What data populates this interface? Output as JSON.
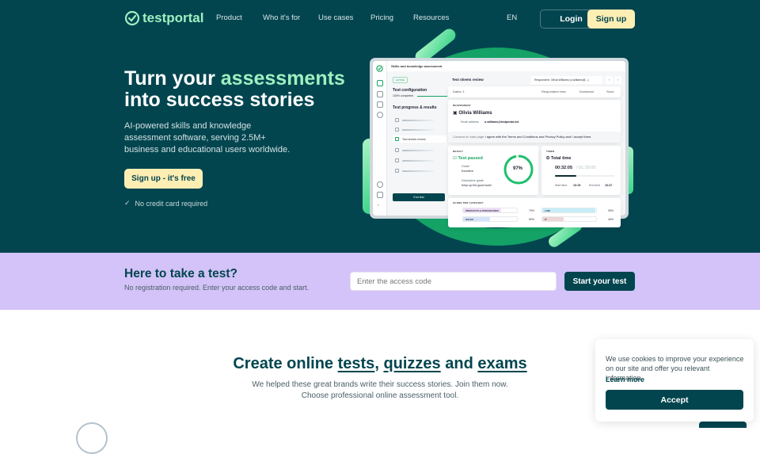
{
  "brand": {
    "name": "testportal",
    "accent": "#9ef0c0",
    "primary": "#02454f",
    "cta": "#fdeeb4",
    "band": "#d3c3f8"
  },
  "nav": {
    "items": [
      "Product",
      "Who it's for",
      "Use cases",
      "Pricing",
      "Resources"
    ],
    "lang": "EN",
    "login": "Login",
    "signup": "Sign up"
  },
  "hero": {
    "title_pre": "Turn your",
    "title_accent": "assessments",
    "title_post": "into success stories",
    "subtitle": "AI-powered skills and knowledge assessment software, serving 2.5M+ business and educational users worldwide.",
    "cta": "Sign up - it's free",
    "note": "No credit card required"
  },
  "app": {
    "title": "Skills and knowledge assessment",
    "status": "ACTIVE",
    "config_title": "Test configuration",
    "config_progress": "100% completed",
    "progress_title": "Test progress & results",
    "active_step": "Test sheets review",
    "end_test": "End test",
    "main_title": "Test sheets review",
    "respondent_select": "Respondent: Olivia Williams (o.williams@...)",
    "dates": "Dates: 1",
    "respondent_view": "Respondent view",
    "download": "Download",
    "send": "Send",
    "respondent_caption": "RESPONDENT",
    "respondent_name": "Olivia Williams",
    "email_label": "Email address",
    "email": "o.williams@testportal.net",
    "consent_label": "Consent on start page",
    "consent_text": "I agree with the Terms and Conditions and Privacy Policy and I accept them.",
    "result_caption": "RESULT",
    "result_status": "Test passed",
    "grade_label": "Grade",
    "grade": "Excellent",
    "desc_grade_label": "Descriptive grade",
    "desc_grade": "Keep up the good work!",
    "score_percent": 97,
    "score_label": "97%",
    "timer_caption": "TIMER",
    "timer_title": "Total time",
    "elapsed": "00:32:05",
    "limit": "01:30:00",
    "time_progress": 0.36,
    "start_label": "Start time",
    "start_time": "10:15",
    "end_label": "End time",
    "end_time": "10:47",
    "score_caption": "SCORE PER CATEGORY",
    "categories": [
      {
        "name": "PRODUCTS & PROCEDURES",
        "pct": 70,
        "label": "70%",
        "color": "#eedcfb"
      },
      {
        "name": "SALES",
        "pct": 50,
        "label": "50%",
        "color": "#d4e2fb"
      },
      {
        "name": "LAW",
        "pct": 99,
        "label": "99%",
        "color": "#c6ecf8"
      },
      {
        "name": "IT",
        "pct": 40,
        "label": "40%",
        "color": "#eed6d6"
      }
    ]
  },
  "test_band": {
    "title": "Here to take a test?",
    "subtitle": "No registration required. Enter your access code and start.",
    "placeholder": "Enter the access code",
    "button": "Start your test"
  },
  "create": {
    "pre": "Create online",
    "w1": "tests",
    "sep": ",",
    "w2": "quizzes",
    "and": "and",
    "w3": "exams",
    "line1": "We helped these great brands write their success stories. Join them now.",
    "line2": "Choose professional online assessment tool."
  },
  "cookie": {
    "text": "We use cookies to improve your experience on our site and offer you relevant information.",
    "learn_more": "Learn more",
    "accept": "Accept"
  }
}
